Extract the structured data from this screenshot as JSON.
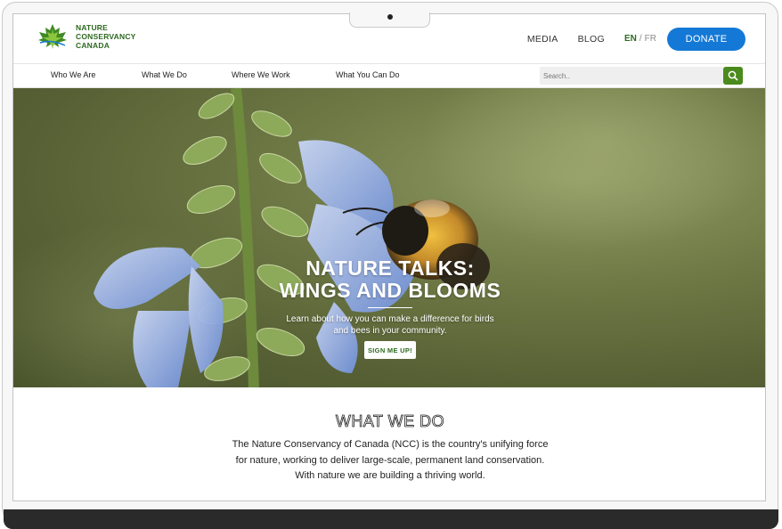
{
  "brand": {
    "logo_lines": [
      "NATURE",
      "CONSERVANCY",
      "CANADA"
    ],
    "primary_color": "#2d6a1f",
    "accent_color": "#1479d6"
  },
  "header": {
    "links": [
      {
        "label": "MEDIA"
      },
      {
        "label": "BLOG"
      }
    ],
    "lang": {
      "active": "EN",
      "separator": "/",
      "other": "FR"
    },
    "donate_label": "DONATE"
  },
  "nav": {
    "items": [
      {
        "label": "Who We Are"
      },
      {
        "label": "What We Do"
      },
      {
        "label": "Where We Work"
      },
      {
        "label": "What You Can Do"
      }
    ],
    "search": {
      "placeholder": "Search..",
      "icon": "search-icon"
    }
  },
  "hero": {
    "title_line1": "NATURE TALKS:",
    "title_line2": "WINGS AND BLOOMS",
    "subtitle_line1": "Learn about how you can make a difference for birds",
    "subtitle_line2": "and bees in your community.",
    "cta_label": "SIGN ME UP!"
  },
  "what_we_do": {
    "title": "WHAT WE DO",
    "body_lines": [
      "The Nature Conservancy of Canada (NCC) is the country's unifying force",
      "for nature, working to deliver large-scale, permanent land conservation.",
      "With nature we are building a thriving world."
    ]
  }
}
